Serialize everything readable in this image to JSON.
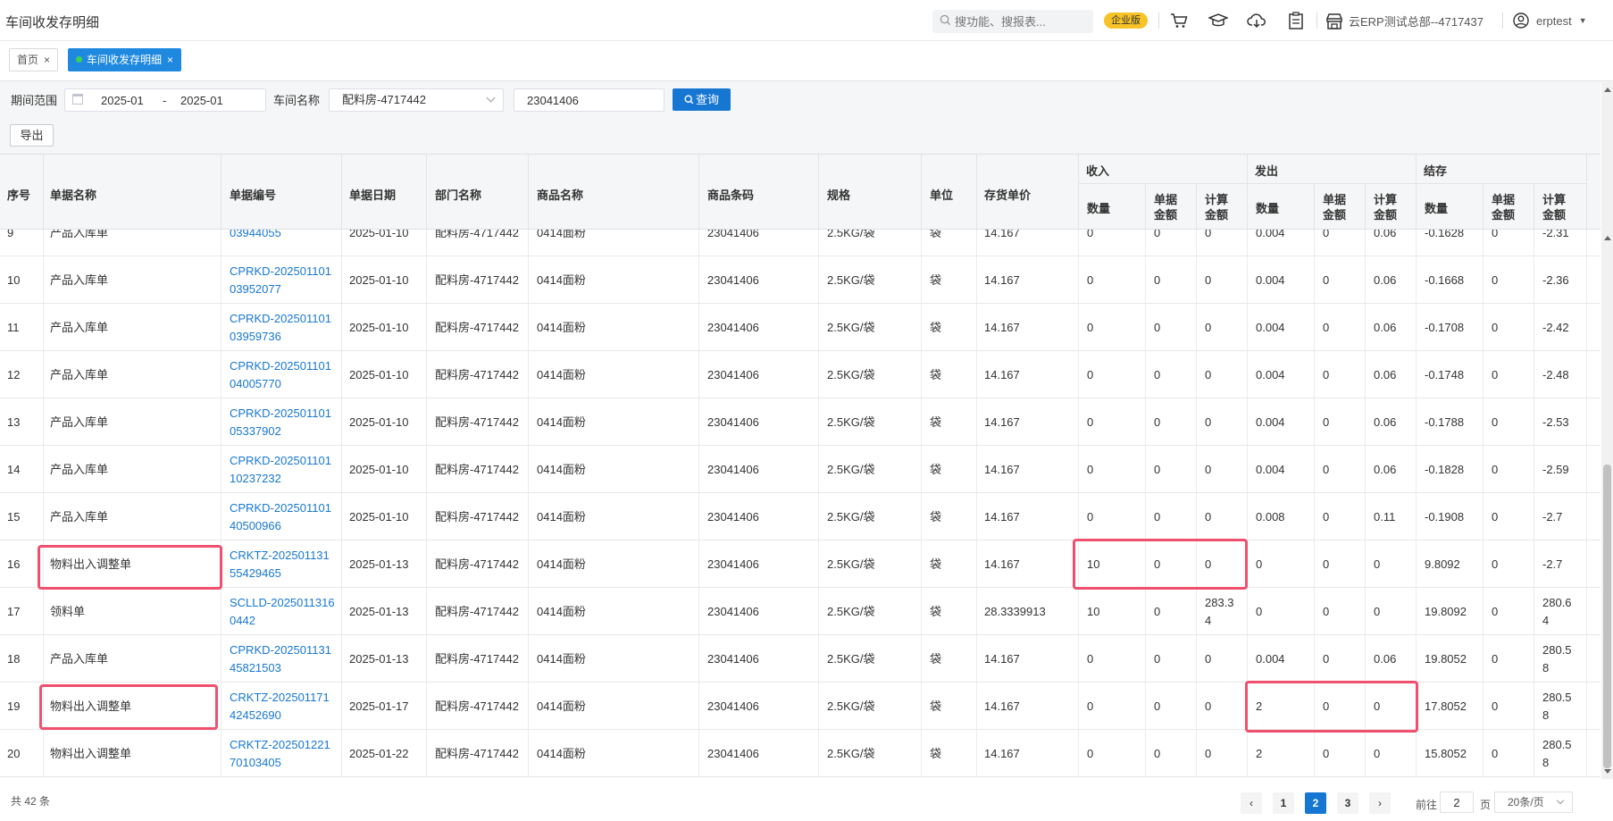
{
  "header": {
    "title": "车间收发存明细",
    "search_placeholder": "搜功能、搜报表...",
    "edition": "企业版",
    "company": "云ERP测试总部--4717437",
    "user": "erptest"
  },
  "tabs": [
    {
      "label": "首页",
      "active": false
    },
    {
      "label": "车间收发存明细",
      "active": true
    }
  ],
  "filters": {
    "period_label": "期间范围",
    "period_start": "2025-01",
    "period_sep": "-",
    "period_end": "2025-01",
    "workshop_label": "车间名称",
    "workshop_value": "配料房-4717442",
    "code_value": "23041406",
    "query_label": "查询",
    "export_label": "导出"
  },
  "table": {
    "headers": {
      "seq": "序号",
      "doc_name": "单据名称",
      "doc_no": "单据编号",
      "doc_date": "单据日期",
      "dept": "部门名称",
      "product": "商品名称",
      "barcode": "商品条码",
      "spec": "规格",
      "unit": "单位",
      "cost": "存货单价",
      "in_group": "收入",
      "out_group": "发出",
      "bal_group": "结存",
      "qty": "数量",
      "unit_amt_1": "单据",
      "unit_amt_2": "金额",
      "calc_amt_1": "计算",
      "calc_amt_2": "金额"
    },
    "rows": [
      {
        "seq": "9",
        "doc_name": "产品入库单",
        "doc_no_1": "",
        "doc_no_2": "03944055",
        "date": "2025-01-10",
        "dept": "配料房-4717442",
        "product": "0414面粉",
        "barcode": "23041406",
        "spec": "2.5KG/袋",
        "unit": "袋",
        "cost": "14.167",
        "in_qty": "0",
        "in_unit": "0",
        "in_calc": "0",
        "out_qty": "0.004",
        "out_unit": "0",
        "out_calc": "0.06",
        "bal_qty": "-0.1628",
        "bal_unit": "0",
        "bal_calc": "-2.31",
        "partial": true
      },
      {
        "seq": "10",
        "doc_name": "产品入库单",
        "doc_no_1": "CPRKD-202501101",
        "doc_no_2": "03952077",
        "date": "2025-01-10",
        "dept": "配料房-4717442",
        "product": "0414面粉",
        "barcode": "23041406",
        "spec": "2.5KG/袋",
        "unit": "袋",
        "cost": "14.167",
        "in_qty": "0",
        "in_unit": "0",
        "in_calc": "0",
        "out_qty": "0.004",
        "out_unit": "0",
        "out_calc": "0.06",
        "bal_qty": "-0.1668",
        "bal_unit": "0",
        "bal_calc": "-2.36"
      },
      {
        "seq": "11",
        "doc_name": "产品入库单",
        "doc_no_1": "CPRKD-202501101",
        "doc_no_2": "03959736",
        "date": "2025-01-10",
        "dept": "配料房-4717442",
        "product": "0414面粉",
        "barcode": "23041406",
        "spec": "2.5KG/袋",
        "unit": "袋",
        "cost": "14.167",
        "in_qty": "0",
        "in_unit": "0",
        "in_calc": "0",
        "out_qty": "0.004",
        "out_unit": "0",
        "out_calc": "0.06",
        "bal_qty": "-0.1708",
        "bal_unit": "0",
        "bal_calc": "-2.42"
      },
      {
        "seq": "12",
        "doc_name": "产品入库单",
        "doc_no_1": "CPRKD-202501101",
        "doc_no_2": "04005770",
        "date": "2025-01-10",
        "dept": "配料房-4717442",
        "product": "0414面粉",
        "barcode": "23041406",
        "spec": "2.5KG/袋",
        "unit": "袋",
        "cost": "14.167",
        "in_qty": "0",
        "in_unit": "0",
        "in_calc": "0",
        "out_qty": "0.004",
        "out_unit": "0",
        "out_calc": "0.06",
        "bal_qty": "-0.1748",
        "bal_unit": "0",
        "bal_calc": "-2.48"
      },
      {
        "seq": "13",
        "doc_name": "产品入库单",
        "doc_no_1": "CPRKD-202501101",
        "doc_no_2": "05337902",
        "date": "2025-01-10",
        "dept": "配料房-4717442",
        "product": "0414面粉",
        "barcode": "23041406",
        "spec": "2.5KG/袋",
        "unit": "袋",
        "cost": "14.167",
        "in_qty": "0",
        "in_unit": "0",
        "in_calc": "0",
        "out_qty": "0.004",
        "out_unit": "0",
        "out_calc": "0.06",
        "bal_qty": "-0.1788",
        "bal_unit": "0",
        "bal_calc": "-2.53"
      },
      {
        "seq": "14",
        "doc_name": "产品入库单",
        "doc_no_1": "CPRKD-202501101",
        "doc_no_2": "10237232",
        "date": "2025-01-10",
        "dept": "配料房-4717442",
        "product": "0414面粉",
        "barcode": "23041406",
        "spec": "2.5KG/袋",
        "unit": "袋",
        "cost": "14.167",
        "in_qty": "0",
        "in_unit": "0",
        "in_calc": "0",
        "out_qty": "0.004",
        "out_unit": "0",
        "out_calc": "0.06",
        "bal_qty": "-0.1828",
        "bal_unit": "0",
        "bal_calc": "-2.59"
      },
      {
        "seq": "15",
        "doc_name": "产品入库单",
        "doc_no_1": "CPRKD-202501101",
        "doc_no_2": "40500966",
        "date": "2025-01-10",
        "dept": "配料房-4717442",
        "product": "0414面粉",
        "barcode": "23041406",
        "spec": "2.5KG/袋",
        "unit": "袋",
        "cost": "14.167",
        "in_qty": "0",
        "in_unit": "0",
        "in_calc": "0",
        "out_qty": "0.008",
        "out_unit": "0",
        "out_calc": "0.11",
        "bal_qty": "-0.1908",
        "bal_unit": "0",
        "bal_calc": "-2.7"
      },
      {
        "seq": "16",
        "doc_name": "物料出入调整单",
        "doc_no_1": "CRKTZ-202501131",
        "doc_no_2": "55429465",
        "date": "2025-01-13",
        "dept": "配料房-4717442",
        "product": "0414面粉",
        "barcode": "23041406",
        "spec": "2.5KG/袋",
        "unit": "袋",
        "cost": "14.167",
        "in_qty": "10",
        "in_unit": "0",
        "in_calc": "0",
        "out_qty": "0",
        "out_unit": "0",
        "out_calc": "0",
        "bal_qty": "9.8092",
        "bal_unit": "0",
        "bal_calc": "-2.7"
      },
      {
        "seq": "17",
        "doc_name": "领料单",
        "doc_no_1": "SCLLD-2025011316",
        "doc_no_2": "0442",
        "date": "2025-01-13",
        "dept": "配料房-4717442",
        "product": "0414面粉",
        "barcode": "23041406",
        "spec": "2.5KG/袋",
        "unit": "袋",
        "cost": "28.3339913",
        "in_qty": "10",
        "in_unit": "0",
        "in_calc": "283.3\n4",
        "out_qty": "0",
        "out_unit": "0",
        "out_calc": "0",
        "bal_qty": "19.8092",
        "bal_unit": "0",
        "bal_calc": "280.6\n4"
      },
      {
        "seq": "18",
        "doc_name": "产品入库单",
        "doc_no_1": "CPRKD-202501131",
        "doc_no_2": "45821503",
        "date": "2025-01-13",
        "dept": "配料房-4717442",
        "product": "0414面粉",
        "barcode": "23041406",
        "spec": "2.5KG/袋",
        "unit": "袋",
        "cost": "14.167",
        "in_qty": "0",
        "in_unit": "0",
        "in_calc": "0",
        "out_qty": "0.004",
        "out_unit": "0",
        "out_calc": "0.06",
        "bal_qty": "19.8052",
        "bal_unit": "0",
        "bal_calc": "280.5\n8"
      },
      {
        "seq": "19",
        "doc_name": "物料出入调整单",
        "doc_no_1": "CRKTZ-202501171",
        "doc_no_2": "42452690",
        "date": "2025-01-17",
        "dept": "配料房-4717442",
        "product": "0414面粉",
        "barcode": "23041406",
        "spec": "2.5KG/袋",
        "unit": "袋",
        "cost": "14.167",
        "in_qty": "0",
        "in_unit": "0",
        "in_calc": "0",
        "out_qty": "2",
        "out_unit": "0",
        "out_calc": "0",
        "bal_qty": "17.8052",
        "bal_unit": "0",
        "bal_calc": "280.5\n8"
      },
      {
        "seq": "20",
        "doc_name": "物料出入调整单",
        "doc_no_1": "CRKTZ-202501221",
        "doc_no_2": "70103405",
        "date": "2025-01-22",
        "dept": "配料房-4717442",
        "product": "0414面粉",
        "barcode": "23041406",
        "spec": "2.5KG/袋",
        "unit": "袋",
        "cost": "14.167",
        "in_qty": "0",
        "in_unit": "0",
        "in_calc": "0",
        "out_qty": "2",
        "out_unit": "0",
        "out_calc": "0",
        "bal_qty": "15.8052",
        "bal_unit": "0",
        "bal_calc": "280.5\n8"
      }
    ]
  },
  "pagination": {
    "total": "共 42 条",
    "pages": [
      "1",
      "2",
      "3"
    ],
    "current": "2",
    "goto_label": "前往",
    "goto_value": "2",
    "page_unit": "页",
    "page_size": "20条/页"
  },
  "colors": {
    "accent": "#1677d2",
    "highlight": "#f0506e",
    "badge": "#f7c326"
  }
}
